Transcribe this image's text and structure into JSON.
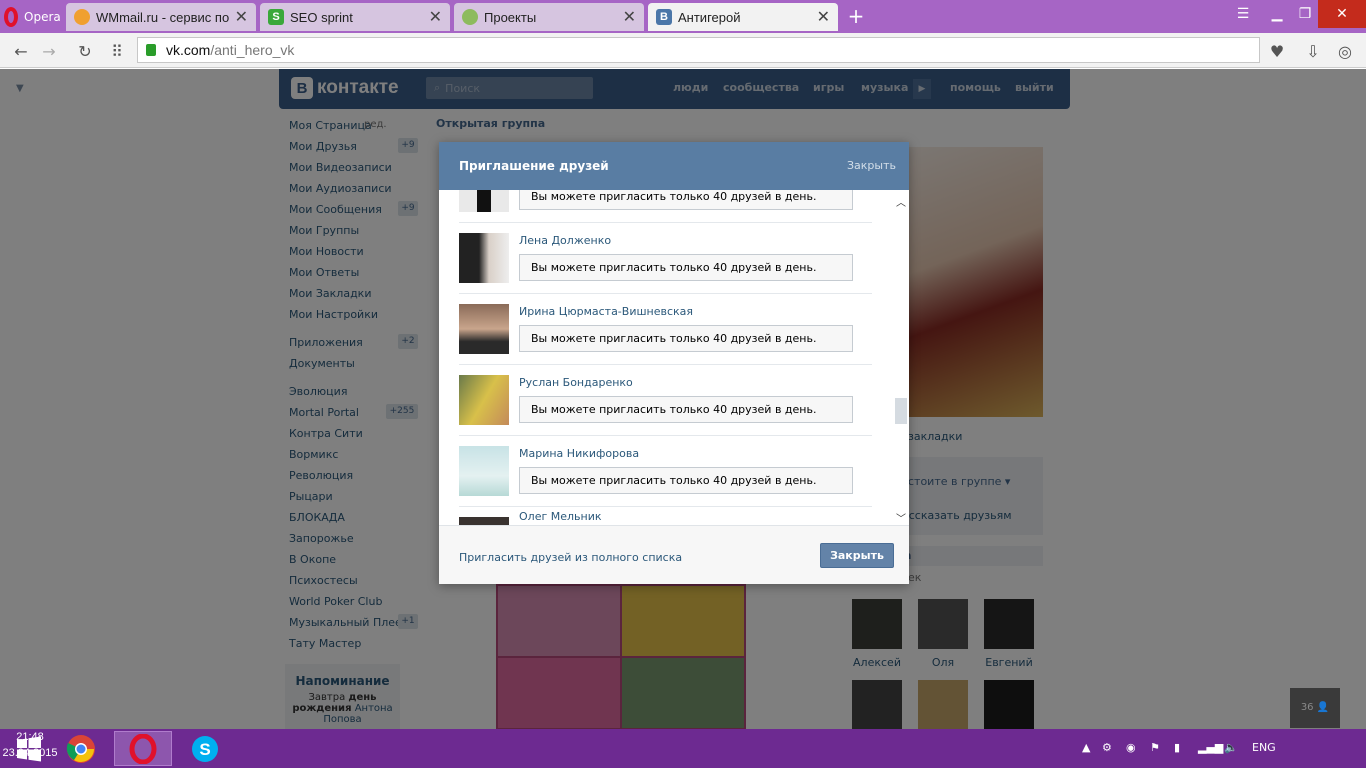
{
  "browser": {
    "name": "Opera",
    "tabs": [
      {
        "label": "WMmail.ru - сервис почто",
        "active": false
      },
      {
        "label": "SEO sprint",
        "active": false
      },
      {
        "label": "Проекты",
        "active": false
      },
      {
        "label": "Антигерой",
        "active": true
      }
    ],
    "url_domain": "vk.com",
    "url_path": "/anti_hero_vk"
  },
  "vk": {
    "logo": "контакте",
    "search_placeholder": "Поиск",
    "nav": [
      "люди",
      "сообщества",
      "игры",
      "музыка",
      "помощь",
      "выйти"
    ],
    "menu": [
      {
        "label": "Моя Страница",
        "extra": "ред."
      },
      {
        "label": "Мои Друзья",
        "count": "+9"
      },
      {
        "label": "Мои Видеозаписи"
      },
      {
        "label": "Мои Аудиозаписи"
      },
      {
        "label": "Мои Сообщения",
        "count": "+9"
      },
      {
        "label": "Мои Группы"
      },
      {
        "label": "Мои Новости"
      },
      {
        "label": "Мои Ответы"
      },
      {
        "label": "Мои Закладки"
      },
      {
        "label": "Мои Настройки"
      },
      {
        "label": "Приложения",
        "count": "+2"
      },
      {
        "label": "Документы"
      },
      {
        "label": "Эволюция"
      },
      {
        "label": "Mortal Portal",
        "count": "+255"
      },
      {
        "label": "Контра Сити"
      },
      {
        "label": "Вормикс"
      },
      {
        "label": "Революция"
      },
      {
        "label": "Рыцари"
      },
      {
        "label": "БЛОКАДА"
      },
      {
        "label": "Запорожье"
      },
      {
        "label": "В Окопе"
      },
      {
        "label": "Психостесы"
      },
      {
        "label": "World Poker Club"
      },
      {
        "label": "Музыкальный Плеер",
        "count": "+1"
      },
      {
        "label": "Тату Мастер"
      }
    ],
    "reminder": {
      "title": "Напоминание",
      "text_line1": "Завтра",
      "text_bold1": "день",
      "text_line2a": "рождения",
      "text_line2b": "Антона",
      "text_line3": "Попова"
    },
    "group_type": "Открытая группа",
    "right": {
      "bookmarks": "закладки",
      "member_status": "стоите в группе",
      "tell_friends": "ассказать друзьям",
      "friends_header": "а",
      "friends_sub": "ек",
      "friends": [
        "Алексей",
        "Оля",
        "Евгений"
      ]
    },
    "corner_count": "36"
  },
  "modal": {
    "title": "Приглашение друзей",
    "close_top": "Закрыть",
    "limit_msg": "Вы можете пригласить только 40 друзей в день.",
    "rows": [
      {
        "name": "",
        "msg": "Вы можете пригласить только 40 друзей в день."
      },
      {
        "name": "Лена Долженко",
        "msg": "Вы можете пригласить только 40 друзей в день."
      },
      {
        "name": "Ирина Цюрмаста-Вишневская",
        "msg": "Вы можете пригласить только 40 друзей в день."
      },
      {
        "name": "Руслан Бондаренко",
        "msg": "Вы можете пригласить только 40 друзей в день."
      },
      {
        "name": "Марина Никифорова",
        "msg": "Вы можете пригласить только 40 друзей в день."
      },
      {
        "name": "Олег Мельник",
        "msg": ""
      }
    ],
    "full_list_link": "Пригласить друзей из полного списка",
    "close_button": "Закрыть"
  },
  "taskbar": {
    "lang": "ENG",
    "time": "21:48",
    "date": "23.04.2015"
  },
  "colors": {
    "opera_tabbar": "#a665c5",
    "taskbar": "#6d2a91",
    "vk_header": "#3b5f8a",
    "modal_header": "#597da3",
    "link": "#2b587a"
  }
}
